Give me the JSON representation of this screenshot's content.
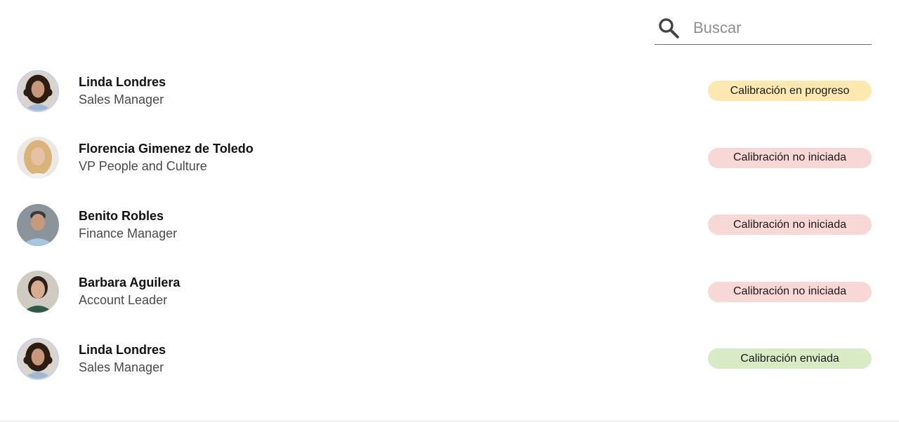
{
  "search": {
    "placeholder": "Buscar",
    "icon": "search-icon"
  },
  "colors": {
    "in_progress": "#fde8b0",
    "not_started": "#f8d7d7",
    "sent": "#d8ebc5",
    "avatar_ring": "#c9cdf1"
  },
  "people": [
    {
      "name": "Linda Londres",
      "role": "Sales Manager",
      "status": "Calibración en progreso",
      "status_color": "#fde8b0"
    },
    {
      "name": "Florencia Gimenez de Toledo",
      "role": "VP People and Culture",
      "status": "Calibración no iniciada",
      "status_color": "#f8d7d7"
    },
    {
      "name": "Benito Robles",
      "role": "Finance Manager",
      "status": "Calibración no iniciada",
      "status_color": "#f8d7d7"
    },
    {
      "name": "Barbara Aguilera",
      "role": "Account Leader",
      "status": "Calibración no iniciada",
      "status_color": "#f8d7d7"
    },
    {
      "name": "Linda Londres",
      "role": "Sales Manager",
      "status": "Calibración enviada",
      "status_color": "#d8ebc5"
    }
  ]
}
